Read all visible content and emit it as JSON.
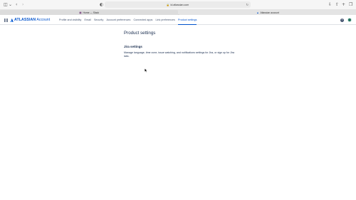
{
  "browser": {
    "url": "id.atlassian.com",
    "tabs": [
      {
        "label": "Home — Slack",
        "active": false
      },
      {
        "label": "Atlassian account",
        "active": true
      }
    ]
  },
  "header": {
    "logo_word1": "ATLASSIAN",
    "logo_word2": "Account",
    "help_label": "?",
    "nav": [
      {
        "label": "Profile and visibility",
        "active": false
      },
      {
        "label": "Email",
        "active": false
      },
      {
        "label": "Security",
        "active": false
      },
      {
        "label": "Account preferences",
        "active": false
      },
      {
        "label": "Connected apps",
        "active": false
      },
      {
        "label": "Link preferences",
        "active": false
      },
      {
        "label": "Product settings",
        "active": true
      }
    ]
  },
  "main": {
    "title": "Product settings",
    "section_title": "Jira settings",
    "section_desc_prefix": "Manage language, time zone, issue watching, and notifications settings for Jira, or sign up for ",
    "section_desc_link": "Jira labs",
    "section_desc_suffix": "."
  },
  "colors": {
    "accent": "#0052cc",
    "text": "#172b4d",
    "subtle": "#42526e",
    "avatar": "#1f6f5c"
  },
  "icons": [
    "sidebar-toggle-icon",
    "chevron-down-icon",
    "back-icon",
    "forward-icon",
    "shield-icon",
    "lock-icon",
    "reload-icon",
    "download-icon",
    "share-icon",
    "new-tab-icon",
    "tabs-overview-icon",
    "app-switcher-icon",
    "atlassian-logo-icon",
    "help-icon"
  ]
}
